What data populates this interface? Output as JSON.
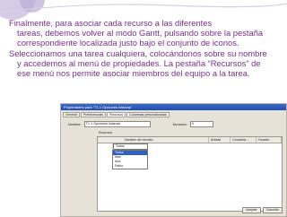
{
  "paragraph_1": {
    "line_1": "Finalmente, para asociar cada recurso a las diferentes",
    "line_2": "tareas, debemos volver al modo Gantt, pulsando sobre la pestaña",
    "line_3": "correspondiente localizada justo bajo el conjunto de iconos."
  },
  "paragraph_2": {
    "line_1": "Seleccionamos una tarea cualquiera, colocándonos sobre su nombre",
    "line_2": "y accedemos al menú de propiedades. La pestaña “Recursos” de",
    "line_3": "ese menú nos permite asociar miembros del equipo a la tarea."
  },
  "screenshot": {
    "window_title": "Propiedades para \"T1.1 Opciones básicas\"",
    "tabs": [
      "General",
      "Predecesoras",
      "Recursos",
      "Columnas personalizadas"
    ],
    "active_tab": "Recursos",
    "name_label": "Nombre:",
    "name_value": "T1.1 Opciones básicas",
    "id_label": "Duración:",
    "id_value": "0",
    "section_label": "Recursos",
    "grid_headers": [
      "Nombre del recurso",
      "Unidad",
      "Coordina...",
      "Función"
    ],
    "selected_value": "Todos",
    "dropdown_options": [
      "Todos",
      "Ibán",
      "Ana",
      "Pablo"
    ],
    "ok_label": "Aceptar",
    "cancel_label": "Cancelar"
  },
  "colors": {
    "text": "#7a2f8a",
    "accent_light": "#c9bde0",
    "accent_dark": "#9e8fbf"
  }
}
